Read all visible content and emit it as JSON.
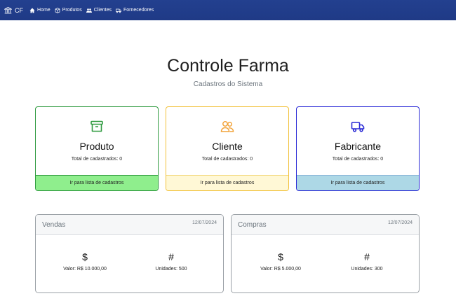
{
  "navbar": {
    "brand": "CF",
    "items": [
      {
        "label": "Home",
        "icon": "home-icon"
      },
      {
        "label": "Produtos",
        "icon": "box-icon"
      },
      {
        "label": "Clientes",
        "icon": "users-icon"
      },
      {
        "label": "Fornecedores",
        "icon": "truck-icon"
      }
    ]
  },
  "header": {
    "title": "Controle Farma",
    "subtitle": "Cadastros do Sistema"
  },
  "cards": [
    {
      "title": "Produto",
      "count": "Total de cadastrados: 0",
      "link": "Ir para lista de cadastros",
      "icon": "archive-icon",
      "color": "#2f9a3f"
    },
    {
      "title": "Cliente",
      "count": "Total de cadastrados: 0",
      "link": "Ir para lista de cadastros",
      "icon": "people-icon",
      "color": "#f2a33a"
    },
    {
      "title": "Fabricante",
      "count": "Total de cadastrados: 0",
      "link": "Ir para lista de cadastros",
      "icon": "truck-icon",
      "color": "#2a2ad6"
    }
  ],
  "panels": [
    {
      "title": "Vendas",
      "date": "12/07/2024",
      "value_symbol": "$",
      "value_label": "Valor: R$ 10.000,00",
      "units_symbol": "#",
      "units_label": "Unidades: 500"
    },
    {
      "title": "Compras",
      "date": "12/07/2024",
      "value_symbol": "$",
      "value_label": "Valor: R$ 5.000,00",
      "units_symbol": "#",
      "units_label": "Unidades: 300"
    }
  ]
}
